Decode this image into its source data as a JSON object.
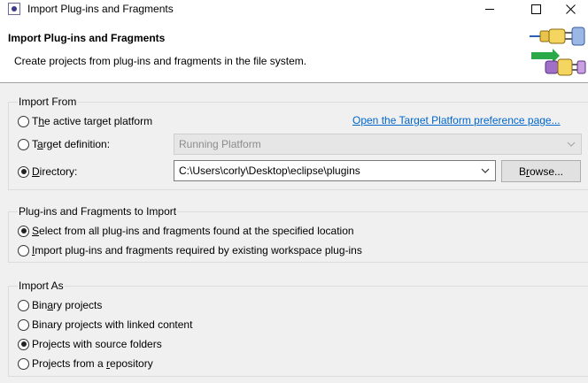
{
  "window": {
    "title": "Import Plug-ins and Fragments"
  },
  "header": {
    "title": "Import Plug-ins and Fragments",
    "description": "Create projects from plug-ins and fragments in the file system."
  },
  "import_from": {
    "label": "Import From",
    "options": [
      {
        "pre": "T",
        "u": "h",
        "post": "e active target platform",
        "selected": false
      },
      {
        "pre": "T",
        "u": "a",
        "post": "rget definition:",
        "selected": false
      },
      {
        "pre": "",
        "u": "D",
        "post": "irectory:",
        "selected": true
      }
    ],
    "preference_link": "Open the Target Platform preference page...",
    "target_definition_value": "Running Platform",
    "directory_value": "C:\\Users\\corly\\Desktop\\eclipse\\plugins",
    "browse_label": {
      "pre": "B",
      "u": "r",
      "post": "owse..."
    }
  },
  "plugins_to_import": {
    "label": "Plug-ins and Fragments to Import",
    "options": [
      {
        "pre": "",
        "u": "S",
        "post": "elect from all plug-ins and fragments found at the specified location",
        "selected": true
      },
      {
        "pre": "",
        "u": "I",
        "post": "mport plug-ins and fragments required by existing workspace plug-ins",
        "selected": false
      }
    ]
  },
  "import_as": {
    "label": "Import As",
    "options": [
      {
        "pre": "Bin",
        "u": "a",
        "post": "ry projects",
        "selected": false
      },
      {
        "pre": "Binary pro",
        "u": "j",
        "post": "ects with linked content",
        "selected": false
      },
      {
        "pre": "Projects with source folders",
        "u": "",
        "post": "",
        "selected": true
      },
      {
        "pre": "Projects from a ",
        "u": "r",
        "post": "epository",
        "selected": false
      }
    ]
  },
  "colors": {
    "link": "#0066cc",
    "background": "#f0f0f0"
  }
}
